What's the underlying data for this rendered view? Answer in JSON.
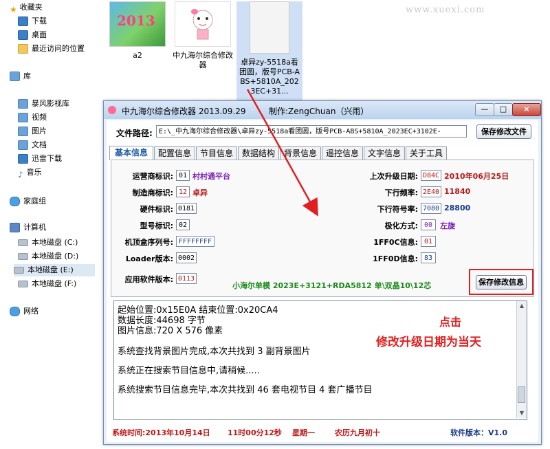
{
  "explorer": {
    "sidebar": {
      "favorites": "收藏夹",
      "fav_items": [
        "下载",
        "桌面",
        "最近访问的位置"
      ],
      "library": "库",
      "lib_items": [
        "暴风影视库",
        "视频",
        "图片",
        "文档",
        "迅雷下载",
        "音乐"
      ],
      "homegroup": "家庭组",
      "computer": "计算机",
      "drives": [
        "本地磁盘 (C:)",
        "本地磁盘 (D:)",
        "本地磁盘 (E:)",
        "本地磁盘 (F:)"
      ],
      "network": "网络"
    },
    "files": [
      {
        "name": "a2"
      },
      {
        "name": "中九海尔综合修改器"
      },
      {
        "name": "卓异zy-5518a看团圆，版号PCB-ABS+5810A_2023EC+31..."
      }
    ],
    "watermark": "www.xuexi.com"
  },
  "app": {
    "title": "中九海尔综合修改器 2013.09.29",
    "author": "制作:ZengChuan（兴雨）",
    "controls": {
      "minimize": "—",
      "maximize": "□",
      "close": "×"
    },
    "path_label": "文件路径:",
    "path_value": "E:\\_中九海尔综合修改器\\卓异zy-5518a看团圆，版号PCB-ABS+5810A_2023EC+3102E-",
    "save_file_label": "保存修改文件",
    "tabs": [
      "基本信息",
      "配置信息",
      "节目信息",
      "数据结构",
      "背景信息",
      "遥控信息",
      "文字信息",
      "关于工具"
    ],
    "active_tab": 0,
    "fields_left": [
      {
        "label": "运营商标识:",
        "value": "01",
        "extra": "村村通平台",
        "extra_color": "#7a1fb8"
      },
      {
        "label": "制造商标识:",
        "value": "12",
        "extra": "卓异",
        "extra_color": "#b81818"
      },
      {
        "label": "硬件标识:",
        "value": "0181",
        "extra": "",
        "extra_color": "#000000"
      },
      {
        "label": "型号标识:",
        "value": "02",
        "extra": "",
        "extra_color": "#000000"
      },
      {
        "label": "机顶盒序列号:",
        "value": "FFFFFFFF",
        "extra": "",
        "extra_color": "#000000"
      },
      {
        "label": "Loader版本:",
        "value": "0002",
        "extra": "",
        "extra_color": "#000000"
      },
      {
        "label": "应用软件版本:",
        "value": "0113",
        "extra": "",
        "extra_color": "#000000"
      }
    ],
    "fields_right": [
      {
        "label": "上次升级日期:",
        "value": "D84C",
        "extra": "2010年06月25日",
        "extra_color": "#b81818"
      },
      {
        "label": "下行频率:",
        "value": "2E40",
        "extra": "11840",
        "extra_color": "#b81818"
      },
      {
        "label": "下行符号率:",
        "value": "7080",
        "extra": "28800",
        "extra_color": "#1a3a8a"
      },
      {
        "label": "极化方式:",
        "value": "00",
        "extra": "左旋",
        "extra_color": "#7a1fb8"
      },
      {
        "label": "1FF0C信息:",
        "value": "01",
        "extra": "",
        "extra_color": "#000000"
      },
      {
        "label": "1FF0D信息:",
        "value": "83",
        "extra": "",
        "extra_color": "#000000"
      }
    ],
    "model_text": "小海尔单模 2023E+3121+RDA5812 单\\双晶10\\12芯",
    "save_info_label": "保存修改信息",
    "log_lines": [
      "起始位置:0x15E0A  结束位置:0x20CA4",
      "数据长度:44698 字节",
      "图片信息:720 X 576 像素",
      "",
      "系统查找背景图片完成,本次共找到 3 副背景图片",
      "",
      "系统正在搜索节目信息中,请稍候.....",
      "",
      "系统搜索节目信息完毕,本次共找到 46 套电视节目 4 套广播节目"
    ],
    "annotation_line1": "点击",
    "annotation_line2": "修改升级日期为当天",
    "status": {
      "time_label": "系统时间:2013年10月14日",
      "clock": "11时00分12秒",
      "weekday": "星期一",
      "lunar": "农历九月初十",
      "version": "软件版本：V1.0"
    }
  },
  "colors": {
    "accent_red": "#e02020",
    "tab_active": "#1c59a8",
    "model_green": "#1a8a1a"
  }
}
